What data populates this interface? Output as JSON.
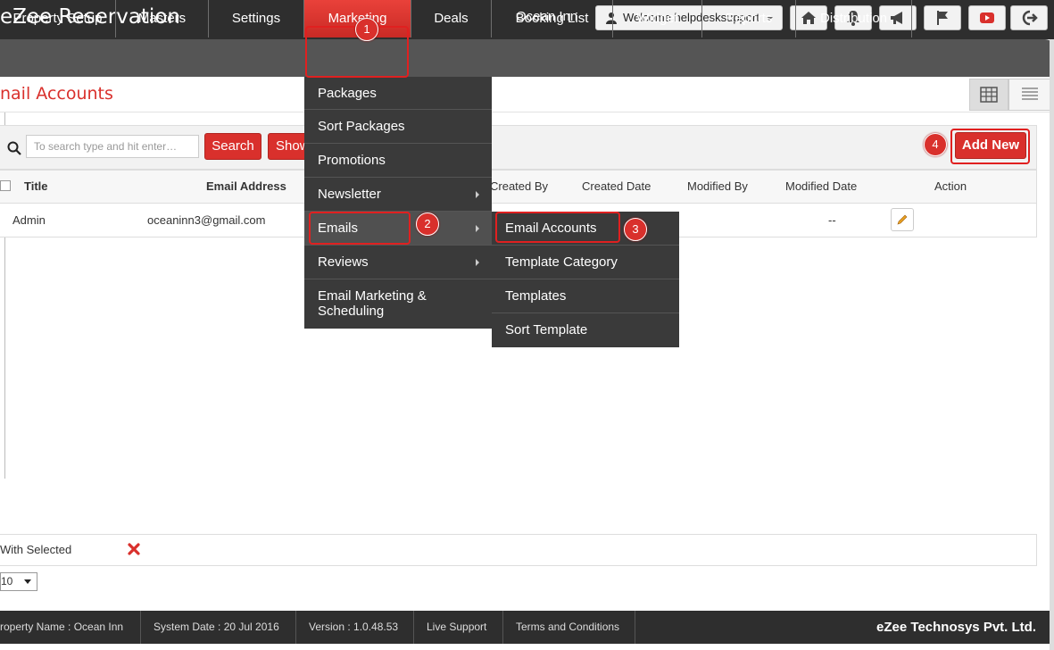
{
  "app": {
    "title": "eZee Reservation",
    "property": "Ocean Inn",
    "welcome": "Welcome helpdesksupport"
  },
  "toolbar_icons": [
    "home-icon",
    "bell-icon",
    "megaphone-icon",
    "flag-icon",
    "youtube-icon",
    "logout-icon"
  ],
  "nav": [
    "Property Setup",
    "Masters",
    "Settings",
    "Marketing",
    "Deals",
    "Booking List",
    "Widget",
    "Reports",
    "Distribution"
  ],
  "page": {
    "title": "nail Accounts"
  },
  "filter": {
    "placeholder": "To search type and hit enter…",
    "search_label": "Search",
    "show_label": "Show",
    "add_new_label": "Add New"
  },
  "table": {
    "columns": [
      "Title",
      "Email Address",
      "Created By",
      "Created Date",
      "Modified By",
      "Modified Date",
      "Action"
    ],
    "rows": [
      {
        "title": "Admin",
        "email": "oceaninn3@gmail.com",
        "modified_date": "--"
      }
    ]
  },
  "marketing_menu": [
    "Packages",
    "Sort Packages",
    "Promotions",
    "Newsletter",
    "Emails",
    "Reviews",
    "Email Marketing & Scheduling"
  ],
  "emails_submenu": [
    "Email Accounts",
    "Template Category",
    "Templates",
    "Sort Template"
  ],
  "callouts": [
    "1",
    "2",
    "3",
    "4"
  ],
  "bottom": {
    "with_selected": "With Selected",
    "page_size": "10"
  },
  "footer": {
    "property_name": "roperty Name : Ocean Inn",
    "system_date": "System Date : 20 Jul 2016",
    "version": "Version : 1.0.48.53",
    "live_support": "Live Support",
    "terms": "Terms and Conditions",
    "brand": "eZee Technosys Pvt. Ltd."
  },
  "colors": {
    "accent": "#d9302c",
    "topbar": "#2e2e2e",
    "navbar": "#555555",
    "menu": "#3a3a3a"
  }
}
